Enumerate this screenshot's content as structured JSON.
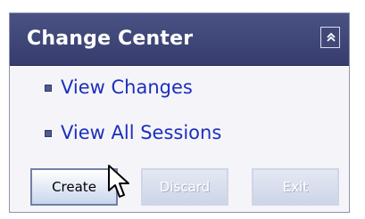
{
  "panel": {
    "title": "Change Center",
    "collapse_icon": "chevron-up-icon"
  },
  "links": [
    {
      "label": "View Changes"
    },
    {
      "label": "View All Sessions"
    }
  ],
  "buttons": {
    "create": "Create",
    "discard": "Discard",
    "exit": "Exit"
  },
  "colors": {
    "header": "#3f4677",
    "link": "#1c2fbc",
    "disabled_text": "#ffffff"
  },
  "cursor_icon": "mouse-pointer-icon"
}
